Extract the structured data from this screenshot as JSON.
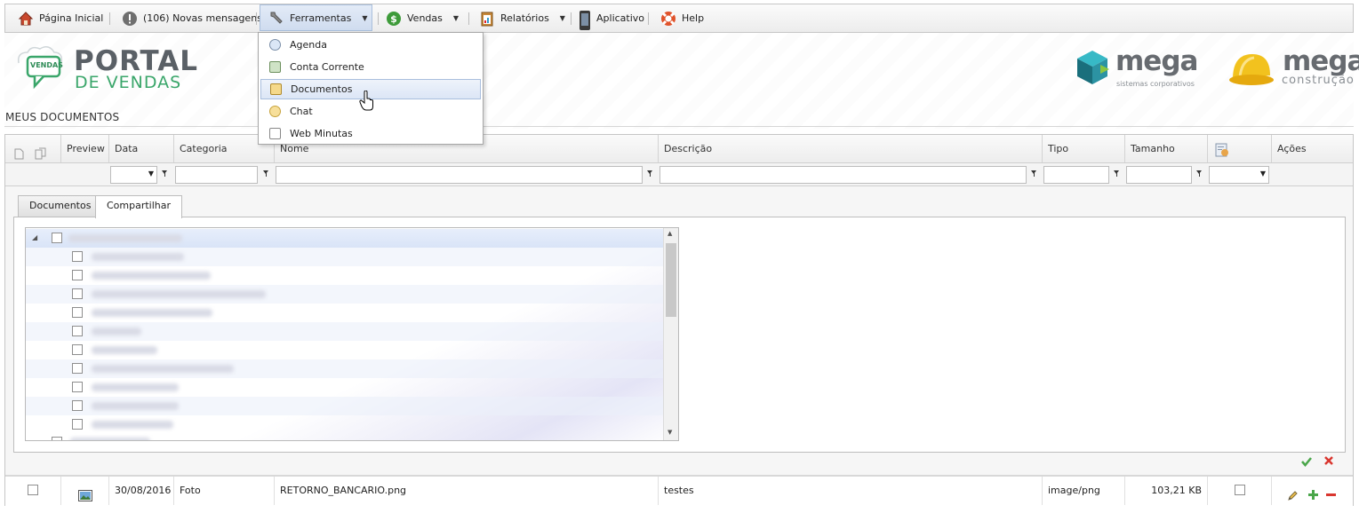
{
  "topnav": {
    "home": "Página Inicial",
    "messages": "(106) Novas mensagens",
    "tools": "Ferramentas",
    "sales": "Vendas",
    "reports": "Relatórios",
    "app": "Aplicativo",
    "help": "Help"
  },
  "tools_menu": {
    "items": [
      "Agenda",
      "Conta Corrente",
      "Documentos",
      "Chat",
      "Web Minutas"
    ]
  },
  "brand": {
    "portal_line1": "PORTAL",
    "portal_line2": "DE VENDAS",
    "badge": "VENDAS",
    "mega1": "mega",
    "mega1_sub": "sistemas corporativos",
    "mega2": "mega",
    "mega2_sub": "construção"
  },
  "page": {
    "title": "MEUS DOCUMENTOS"
  },
  "grid": {
    "columns": [
      "Preview",
      "Data",
      "Categoria",
      "Nome",
      "Descrição",
      "Tipo",
      "Tamanho",
      "Ações"
    ],
    "tabs": [
      "Documentos",
      "Compartilhar"
    ],
    "row": {
      "date": "30/08/2016",
      "category": "Foto",
      "name": "RETORNO_BANCARIO.png",
      "description": "testes",
      "type": "image/png",
      "size": "103,21 KB"
    }
  },
  "colors": {
    "accent_green": "#4aa64a",
    "brand_teal": "#1a7d8c",
    "cancel_red": "#d9362f"
  }
}
